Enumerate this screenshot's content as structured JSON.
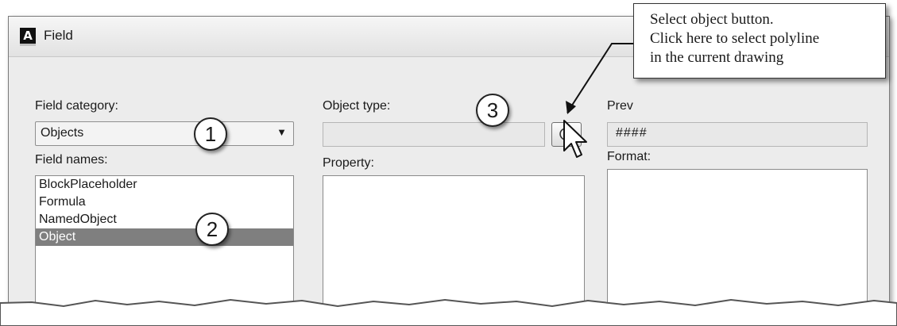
{
  "window": {
    "title": "Field",
    "app_icon": "A"
  },
  "field_category": {
    "label": "Field category:",
    "value": "Objects"
  },
  "field_names": {
    "label": "Field names:",
    "items": [
      "BlockPlaceholder",
      "Formula",
      "NamedObject",
      "Object"
    ],
    "selected_index": 3
  },
  "object_type": {
    "label": "Object type:",
    "value": ""
  },
  "property": {
    "label": "Property:"
  },
  "preview": {
    "label": "Prev",
    "value": "####"
  },
  "format": {
    "label": "Format:"
  },
  "callouts": [
    "1",
    "2",
    "3"
  ],
  "note": {
    "lines": [
      "Select object button.",
      "Click here to select polyline",
      "in the current drawing"
    ]
  },
  "icons": {
    "app": "autocad-a-icon",
    "pick_button": "select-object-icon",
    "dropdown": "chevron-down-icon",
    "cursor": "mouse-pointer-icon"
  },
  "colors": {
    "selection": "#7f7f7f",
    "dialog_bg": "#ececec"
  }
}
